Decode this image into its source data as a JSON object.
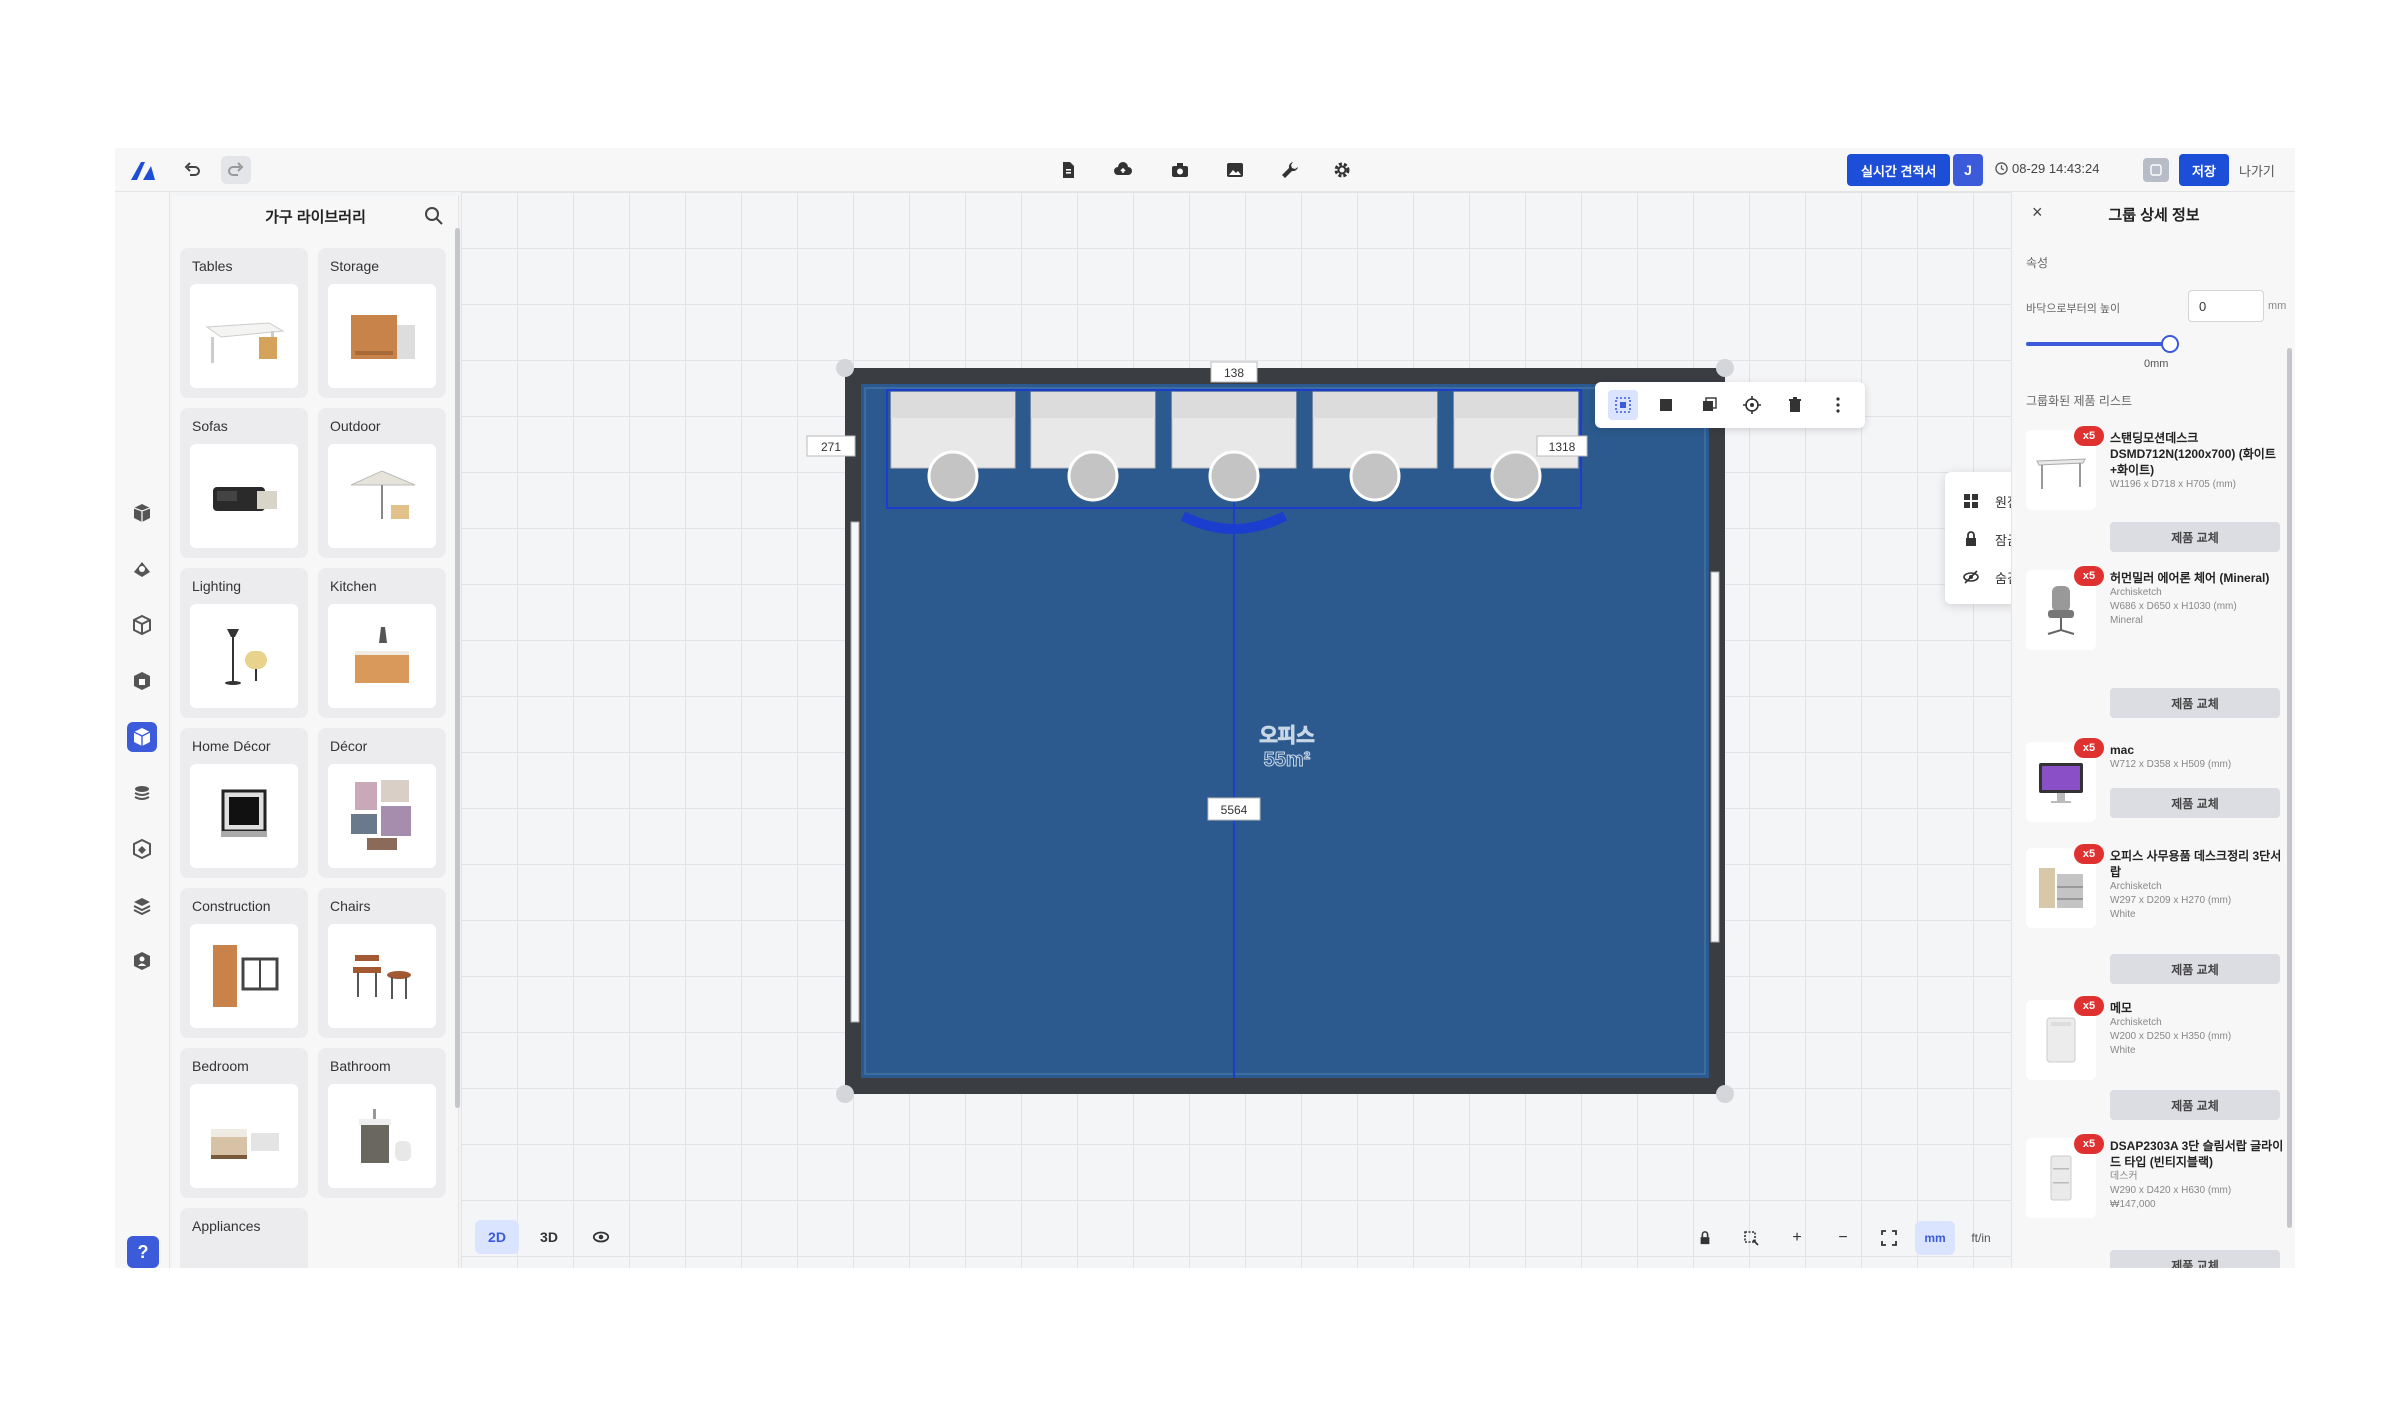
{
  "toolbar": {
    "estimate_label": "실시간 견적서",
    "user_initial": "J",
    "timestamp": "08-29 14:43:24",
    "save_label": "저장",
    "exit_label": "나가기"
  },
  "library": {
    "title": "가구 라이브러리",
    "categories": [
      {
        "label": "Tables"
      },
      {
        "label": "Storage"
      },
      {
        "label": "Sofas"
      },
      {
        "label": "Outdoor"
      },
      {
        "label": "Lighting"
      },
      {
        "label": "Kitchen"
      },
      {
        "label": "Home Décor"
      },
      {
        "label": "Décor"
      },
      {
        "label": "Construction"
      },
      {
        "label": "Chairs"
      },
      {
        "label": "Bedroom"
      },
      {
        "label": "Bathroom"
      },
      {
        "label": "Appliances"
      }
    ]
  },
  "canvas": {
    "dim_top": "138",
    "dim_left": "271",
    "dim_right": "1318",
    "dim_center": "5564",
    "room_label_1": "오피스",
    "room_label_2": "55m²",
    "view_2d": "2D",
    "view_3d": "3D",
    "unit_mm": "mm",
    "unit_ftin": "ft/in"
  },
  "context_menu": {
    "items": [
      "원점복사",
      "잠금",
      "숨김"
    ]
  },
  "panel": {
    "title": "그룹 상세 정보",
    "section_attr": "속성",
    "floor_label": "바닥으로부터의 높이",
    "floor_value": "0",
    "floor_unit": "mm",
    "slider_value_label": "0mm",
    "slider_fraction": 1.0,
    "section_products": "그룹화된 제품 리스트",
    "products": [
      {
        "badge": "x5",
        "name": "스탠딩모션데스크 DSMD712N(1200x700) (화이트+화이트)",
        "meta": [
          "W1196 x D718 x H705 (mm)"
        ],
        "button": "제품 교체"
      },
      {
        "badge": "x5",
        "name": "허먼밀러 에어론 체어 (Mineral)",
        "meta": [
          "Archisketch",
          "W686 x D650 x H1030 (mm)",
          "Mineral"
        ],
        "button": "제품 교체"
      },
      {
        "badge": "x5",
        "name": "mac",
        "meta": [
          "W712 x D358 x H509 (mm)"
        ],
        "button": "제품 교체"
      },
      {
        "badge": "x5",
        "name": "오피스 사무용품 데스크정리 3단서랍",
        "meta": [
          "Archisketch",
          "W297 x D209 x H270 (mm)",
          "White"
        ],
        "button": "제품 교체"
      },
      {
        "badge": "x5",
        "name": "메모",
        "meta": [
          "Archisketch",
          "W200 x D250 x H350 (mm)",
          "White"
        ],
        "button": "제품 교체"
      },
      {
        "badge": "x5",
        "name": "DSAP2303A 3단 슬림서랍 글라이드 타입 (빈티지블랙)",
        "meta": [
          "데스커",
          "W290 x D420 x H630 (mm)",
          "₩147,000"
        ],
        "button": "제품 교체"
      }
    ]
  },
  "colors": {
    "accent": "#1d4ed8",
    "floor": "#2c5a8e",
    "wall": "#3a3d42",
    "badge": "#e03131"
  }
}
